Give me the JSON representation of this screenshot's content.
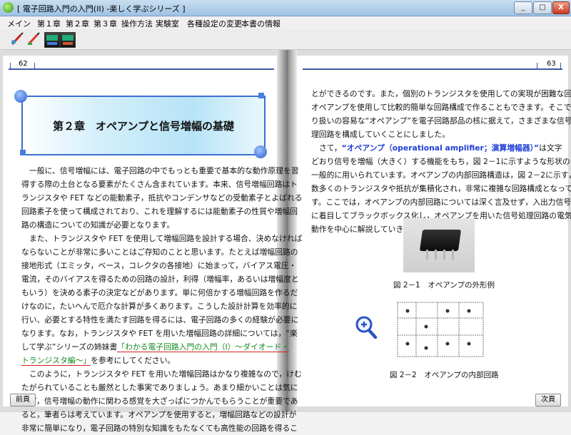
{
  "window": {
    "title": "[ 電子回路入門の入門(II) -楽しく学ぶシリーズ ]",
    "controls": [
      "_",
      "□",
      "X"
    ]
  },
  "menu": [
    "メイン",
    "第１章",
    "第２章",
    "第３章",
    "操作方法",
    "実験室",
    "各種設定の変更",
    "本書の情報"
  ],
  "toolbar": {
    "tools": [
      "pen-tool-icon",
      "marker-tool-icon",
      "zoom-out-icon",
      "zoom-in-icon"
    ]
  },
  "left_page": {
    "page_number": "62",
    "chapter_title": "第２章　オペアンプと信号増幅の基礎",
    "paragraph1": [
      "一般に、信号増幅には、電子回路の中でもっとも重要で基本的な動作原理を習",
      "得する際の土台となる要素がたくさん含まれています。本来、信号増幅回路はト",
      "ランジスタや FET などの能動素子，抵抗やコンデンサなどの受動素子とよばれる",
      "回路素子を使って構成されており、これを理解するには能動素子の性質や増幅回",
      "路の構造についての知識が必要となります。"
    ],
    "paragraph2": [
      "また、トランジスタや FET を使用して増幅回路を設計する場合、決めなければ",
      "ならないことが非常に多いことはご存知のことと思います。たとえば増幅回路の",
      "接地形式（エミッタ，ベース，コレクタの各接地）に始まって，バイアス電圧・",
      "電流，そのバイアスを得るための回路の設計，利得（増幅率，あるいは増幅度と",
      "もいう）を決める素子の決定などがあります。単に何倍かする増幅回路を作るだ",
      "けなのに，たいへんで厄介な計算が多くあります。こうした設計計算を効率的に",
      "行い、必要とする特性を満たす回路を得るには、電子回路の多くの経験が必要に",
      "なります。なお，トランジスタや FET を用いた増幅回路の詳細については，“楽"
    ],
    "para2_line9_pre": "して学ぶ”シリーズの姉妹書",
    "link_part1": "「わかる電子回路入門の入門（I）～ダイオード・",
    "link_part2": "トランジスタ編～」",
    "para2_line10_post": "を参考にしてください。",
    "paragraph3": [
      "このように，トランジスタや FET を用いた増幅回路はかなり複雑なので，けむ",
      "たがられていることも厳然とした事実でありましょう。あまり細かいことは気に",
      "せず，信号増幅の動作に関わる感覚を大ざっぱにつかんでもらうことが重要であ",
      "ると，筆者らは考えています。オペアンプを使用すると，増幅回路などの設計が",
      "非常に簡単になり，電子回路の特別な知識をもたなくても高性能の回路を得るこ"
    ]
  },
  "right_page": {
    "page_number": "63",
    "paragraph1": [
      "とができるのです。また，個別のトランジスタを使用しての実現が困難な回路を，",
      "オペアンプを使用して比較的簡単な回路構成で作ることもできます。そこで，取",
      "り扱いの容易な“オペアンプ”を電子回路部品の核に据えて，さまざまな信号処",
      "理回路を構成していくことにしました。"
    ],
    "para2_pre": "さて，",
    "term": "“オペアンプ（operational amplifier；演算増幅器）”",
    "para2_post": "は文字",
    "paragraph2": [
      "どおり信号を増幅（大きく）する機能をもち，図 2－1に示すような形状のものが",
      "一般的に用いられています。オペアンプの内部回路構造は，図 2－2に示すように，",
      "数多くのトランジスタや抵抗が集積化され，非常に複雑な回路構成となっていま",
      "す。ここでは，オペアンプの内部回路については深く言及せず，入出力信号のみ",
      "に着目してブラックボックス化し，オペアンプを用いた信号処理回路の電気的な",
      "動作を中心に解説していきます。お楽しみに。"
    ],
    "figure1_caption": "図 2－1　オペアンプの外形例",
    "figure2_caption": "図 2－2　オペアンプの内部回路"
  },
  "nav": {
    "prev": "前頁",
    "next": "次頁"
  },
  "colors": {
    "accent_blue": "#3b6fd1",
    "link_green": "#138a1c",
    "term_blue": "#1f3fd8"
  }
}
